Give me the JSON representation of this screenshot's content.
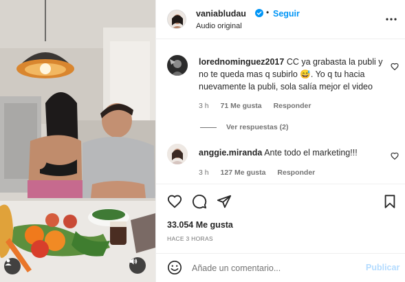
{
  "header": {
    "username": "vaniabludau",
    "follow_label": "Seguir",
    "separator": "•",
    "audio": "Audio original"
  },
  "comments": [
    {
      "username": "lorednominguez2017",
      "text": "CC ya grabasta la publi y no te queda mas q subirlo 😅. Yo q tu hacia nuevamente la publi, sola salía mejor el video",
      "time": "3 h",
      "likes": "71 Me gusta",
      "reply_label": "Responder",
      "view_replies": "Ver respuestas (2)"
    },
    {
      "username": "anggie.miranda",
      "text": "Ante todo el marketing!!!",
      "time": "3 h",
      "likes": "127 Me gusta",
      "reply_label": "Responder"
    }
  ],
  "actions": {
    "likes": "33.054 Me gusta",
    "time": "HACE 3 HORAS"
  },
  "add_comment": {
    "placeholder": "Añade un comentario...",
    "publish_label": "Publicar"
  },
  "colors": {
    "accent": "#0095f6",
    "publish_disabled": "#b3dbff",
    "secondary_text": "#737373"
  },
  "icons": {
    "more": "more-horizontal-icon",
    "like": "heart-icon",
    "comment": "comment-icon",
    "share": "share-icon",
    "save": "bookmark-icon",
    "emoji": "emoji-icon",
    "audio": "speaker-icon",
    "user_tag": "user-tag-icon"
  }
}
